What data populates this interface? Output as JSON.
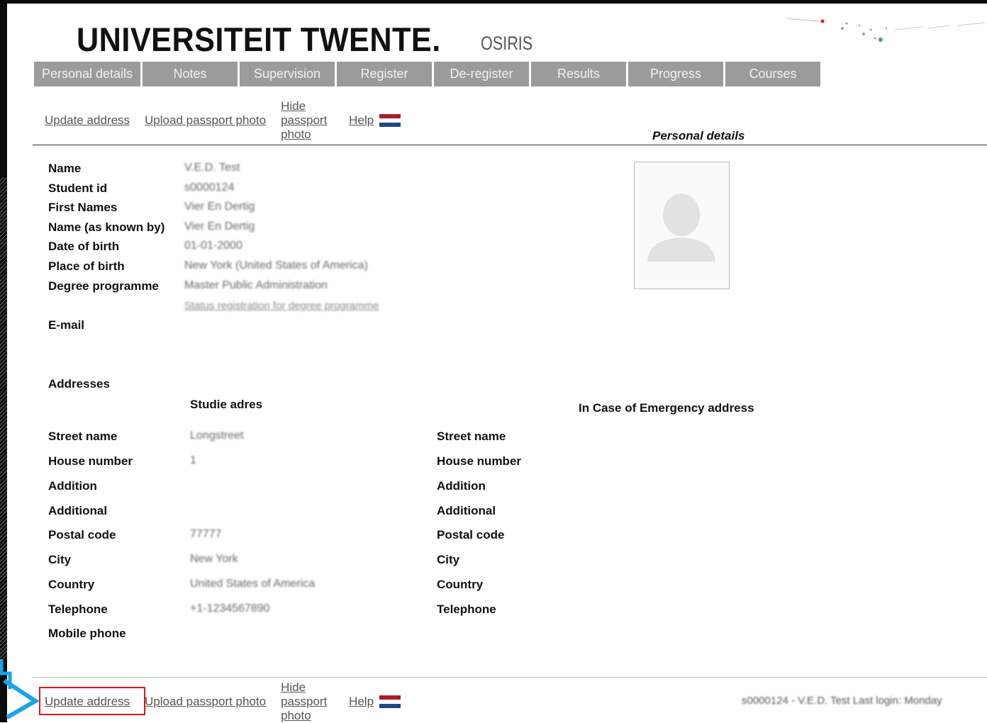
{
  "header": {
    "logo": "UNIVERSITEIT TWENTE.",
    "app_name": "OSIRIS"
  },
  "tabs": [
    "Personal details",
    "Notes",
    "Supervision",
    "Register",
    "De-register",
    "Results",
    "Progress",
    "Courses"
  ],
  "links": {
    "update_address": "Update address",
    "upload_photo": "Upload passport photo",
    "hide_photo": "Hide passport photo",
    "help": "Help"
  },
  "section_title": "Personal details",
  "personal": [
    {
      "label": "Name",
      "value": "V.E.D. Test"
    },
    {
      "label": "Student id",
      "value": "s0000124"
    },
    {
      "label": "First Names",
      "value": "Vier En Dertig"
    },
    {
      "label": "Name (as known by)",
      "value": "Vier En Dertig"
    },
    {
      "label": "Date of birth",
      "value": "01-01-2000"
    },
    {
      "label": "Place of birth",
      "value": "New York (United States of America)"
    },
    {
      "label": "Degree programme",
      "value": "Master Public Administration"
    }
  ],
  "status_link": "Status registration for degree programme",
  "email_label": "E-mail",
  "addresses": {
    "heading": "Addresses",
    "study_heading": "Studie adres",
    "emergency_heading": "In Case of Emergency address",
    "study": [
      {
        "label": "Street name",
        "value": "Longstreet"
      },
      {
        "label": "House number",
        "value": "1"
      },
      {
        "label": "Addition",
        "value": ""
      },
      {
        "label": "Additional",
        "value": ""
      },
      {
        "label": "Postal code",
        "value": "77777"
      },
      {
        "label": "City",
        "value": "New York"
      },
      {
        "label": "Country",
        "value": "United States of America"
      },
      {
        "label": "Telephone",
        "value": "+1-1234567890"
      },
      {
        "label": "Mobile phone",
        "value": ""
      }
    ],
    "emergency_labels": [
      "Street name",
      "House number",
      "Addition",
      "Additional",
      "Postal code",
      "City",
      "Country",
      "Telephone"
    ]
  },
  "footer": {
    "status": "s0000124 - V.E.D. Test    Last login: Monday"
  },
  "colors": {
    "tab_bg": "#9b9b9b",
    "highlight": "#e0141e",
    "pointer": "#1aa3e8",
    "flag_red": "#ae1c28",
    "flag_blue": "#21468b"
  }
}
